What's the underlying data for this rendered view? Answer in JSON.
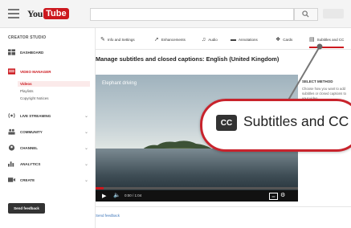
{
  "header": {
    "logo_you": "You",
    "logo_tube": "Tube"
  },
  "sidebar": {
    "title": "CREATOR STUDIO",
    "items": [
      {
        "label": "DASHBOARD",
        "icon": "dashboard-icon"
      },
      {
        "label": "VIDEO MANAGER",
        "icon": "video-manager-icon",
        "active": true
      },
      {
        "label": "LIVE STREAMING",
        "icon": "live-icon"
      },
      {
        "label": "COMMUNITY",
        "icon": "community-icon"
      },
      {
        "label": "CHANNEL",
        "icon": "channel-icon"
      },
      {
        "label": "ANALYTICS",
        "icon": "analytics-icon"
      },
      {
        "label": "CREATE",
        "icon": "create-icon"
      }
    ],
    "subitems": [
      "Videos",
      "Playlists",
      "Copyright Notices"
    ],
    "feedback_button": "Send feedback"
  },
  "tabs": [
    {
      "label": "Info and Settings",
      "icon": "pencil-icon"
    },
    {
      "label": "Enhancements",
      "icon": "wand-icon"
    },
    {
      "label": "Audio",
      "icon": "music-icon"
    },
    {
      "label": "Annotations",
      "icon": "annotation-icon"
    },
    {
      "label": "Cards",
      "icon": "info-icon"
    },
    {
      "label": "Subtitles and CC",
      "icon": "cc-icon",
      "active": true
    }
  ],
  "page_heading": "Manage subtitles and closed captions: English (United Kingdom)",
  "video": {
    "title": "Elephant driving",
    "time": "0:00 / 1:04"
  },
  "right_panel": {
    "label": "SELECT METHOD",
    "text": "Choose how you want to add subtitles or closed captions to your video"
  },
  "bottom_link": "Send feedback",
  "callout": {
    "badge": "CC",
    "text": "Subtitles and CC"
  },
  "colors": {
    "accent": "#cc181e",
    "callout_border": "#c8232c"
  }
}
